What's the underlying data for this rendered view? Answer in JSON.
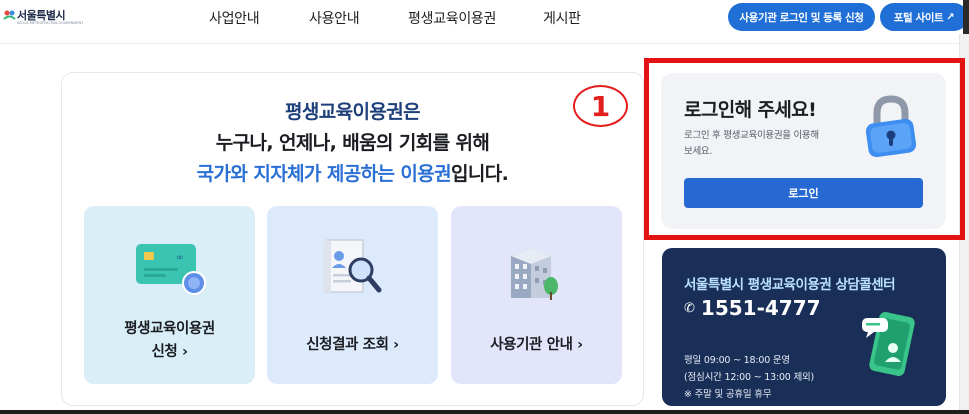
{
  "header": {
    "logo_text": "서울특별시",
    "logo_sub": "SEOUL METROPOLITAN GOVERNMENT",
    "nav": [
      "사업안내",
      "사용안내",
      "평생교육이용권",
      "게시판"
    ],
    "btn_register": "사용기관 로그인 및 등록 신청",
    "btn_portal": "포털 사이트",
    "btn_portal_arrow": "↗"
  },
  "hero": {
    "line1": "평생교육이용권은",
    "line2": "누구나, 언제나, 배움의 기회를 위해",
    "line3_accent": "국가와 지자체가 제공하는 이용권",
    "line3_rest": "입니다."
  },
  "tiles": [
    {
      "line1": "평생교육이용권",
      "line2": "신청 ›",
      "bg": "#d9eef6"
    },
    {
      "line1": "신청결과 조회 ›",
      "bg": "#dceafb"
    },
    {
      "line1": "사용기관 안내 ›",
      "bg": "#e3e6fb"
    }
  ],
  "annotation": {
    "number": "1"
  },
  "login": {
    "title": "로그인해 주세요!",
    "desc": "로그인 후 평생교육이용권을 이용해보세요.",
    "button": "로그인"
  },
  "callcenter": {
    "title": "서울특별시 평생교육이용권 상담콜센터",
    "phone": "1551-4777",
    "hours": "평일 09:00 ~ 18:00 운영",
    "lunch": "(점심시간 12:00 ~ 13:00 제외)",
    "closed": "※ 주말 및 공휴일 휴무"
  },
  "colors": {
    "accent": "#2a6fd4",
    "navy": "#1a2f58",
    "annotation_red": "#e41313"
  }
}
